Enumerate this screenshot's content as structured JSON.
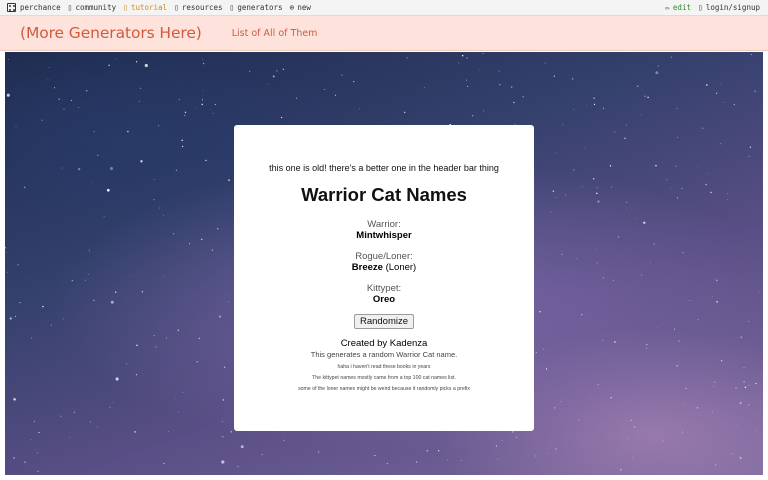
{
  "topbar": {
    "brand": "perchance",
    "community": "community",
    "tutorial": "tutorial",
    "resources": "resources",
    "generators": "generators",
    "new": "new",
    "edit": "edit",
    "login": "login/signup"
  },
  "header": {
    "brand": "(More Generators Here)",
    "list_link": "List of All of Them"
  },
  "card": {
    "note": "this one is old! there's a better one in the header bar thing",
    "title": "Warrior Cat Names",
    "warrior_label": "Warrior:",
    "warrior_value": "Mintwhisper",
    "rogue_label": "Rogue/Loner:",
    "rogue_value": "Breeze",
    "rogue_suffix": "(Loner)",
    "kittypet_label": "Kittypet:",
    "kittypet_value": "Oreo",
    "button": "Randomize",
    "credit": "Created by Kadenza",
    "description": "This generates a random Warrior Cat name.",
    "small_notes": [
      "haha i haven't read these books in years",
      "The kittypet names mostly came from a top 100 cat names list.",
      "some of the loner names might be weird because it randomly picks a prefix"
    ]
  },
  "colors": {
    "header_bg": "#fde3dc",
    "header_text": "#d35b3d",
    "tutorial": "#d58a1c",
    "edit": "#2e8b2e"
  },
  "icons": [
    "dice-icon",
    "community-icon",
    "tutorial-icon",
    "resources-icon",
    "generators-icon",
    "new-icon",
    "edit-icon",
    "login-icon"
  ]
}
